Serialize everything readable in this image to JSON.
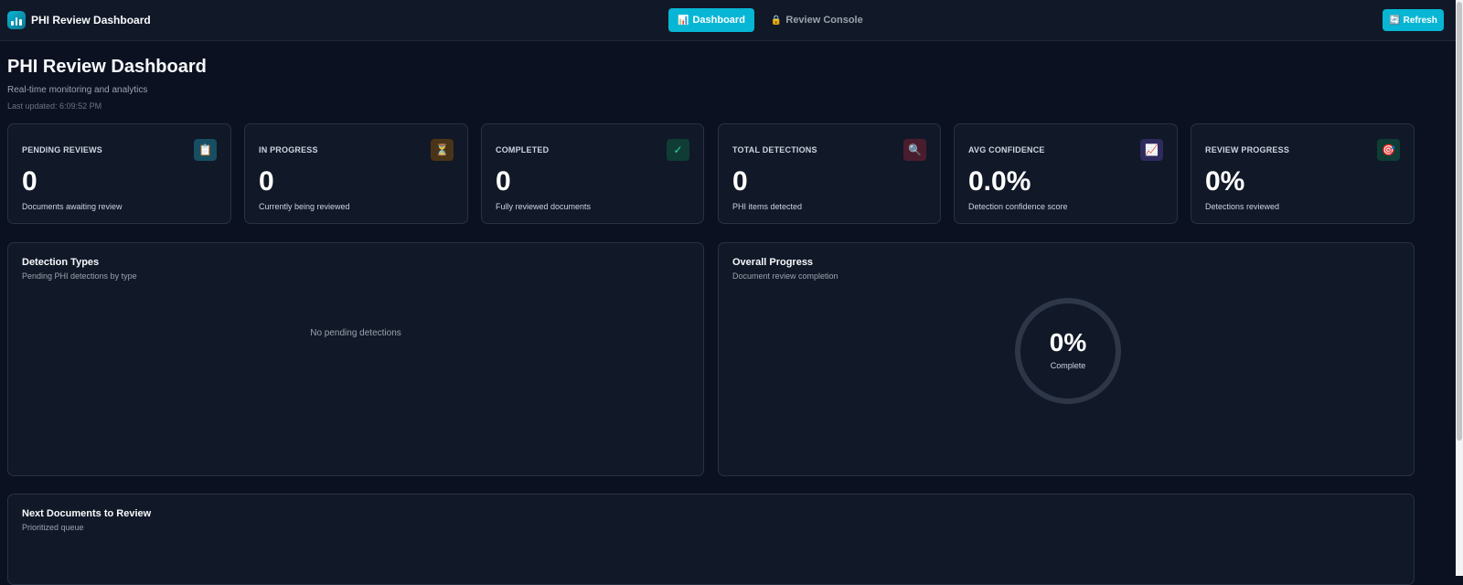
{
  "app": {
    "title": "PHI Review Dashboard",
    "icon": "bar-chart-icon"
  },
  "nav": {
    "tabs": [
      {
        "label": "Dashboard",
        "icon": "📊",
        "active": true
      },
      {
        "label": "Review Console",
        "icon": "🔒",
        "active": false
      }
    ],
    "refresh_label": "Refresh",
    "refresh_icon": "🔄"
  },
  "header": {
    "title": "PHI Review Dashboard",
    "subtitle": "Real-time monitoring and analytics",
    "last_updated": "Last updated: 6:09:52 PM"
  },
  "stats": [
    {
      "label": "PENDING REVIEWS",
      "value": "0",
      "desc": "Documents awaiting review",
      "icon": "📋",
      "icon_bg": "#164e63"
    },
    {
      "label": "IN PROGRESS",
      "value": "0",
      "desc": "Currently being reviewed",
      "icon": "⏳",
      "icon_bg": "#4a3418"
    },
    {
      "label": "COMPLETED",
      "value": "0",
      "desc": "Fully reviewed documents",
      "icon": "✓",
      "icon_bg": "#0f3d36"
    },
    {
      "label": "TOTAL DETECTIONS",
      "value": "0",
      "desc": "PHI items detected",
      "icon": "🔍",
      "icon_bg": "#4a1d2e"
    },
    {
      "label": "AVG CONFIDENCE",
      "value": "0.0%",
      "desc": "Detection confidence score",
      "icon": "📈",
      "icon_bg": "#2e2a5e"
    },
    {
      "label": "REVIEW PROGRESS",
      "value": "0%",
      "desc": "Detections reviewed",
      "icon": "🎯",
      "icon_bg": "#0f3d36"
    }
  ],
  "detection_types": {
    "title": "Detection Types",
    "subtitle": "Pending PHI detections by type",
    "empty": "No pending detections"
  },
  "overall_progress": {
    "title": "Overall Progress",
    "subtitle": "Document review completion",
    "value": "0%",
    "label": "Complete",
    "fraction": 0
  },
  "queue": {
    "title": "Next Documents to Review",
    "subtitle": "Prioritized queue"
  },
  "colors": {
    "accent": "#06b6d4",
    "background": "#0b1120",
    "card": "#111827"
  }
}
